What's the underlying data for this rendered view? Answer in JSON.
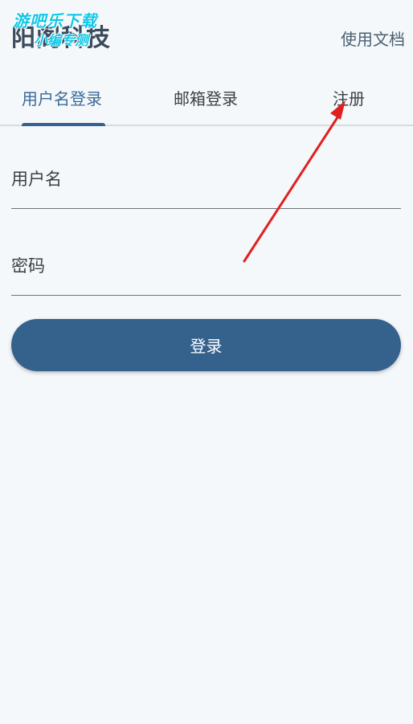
{
  "header": {
    "title": "阳阁科技",
    "docs_link": "使用文档",
    "watermark_line1": "游吧乐下载",
    "watermark_line2": "小编专测"
  },
  "tabs": [
    {
      "label": "用户名登录",
      "active": true
    },
    {
      "label": "邮箱登录",
      "active": false
    },
    {
      "label": "注册",
      "active": false
    }
  ],
  "form": {
    "username_placeholder": "用户名",
    "password_placeholder": "密码",
    "login_label": "登录"
  },
  "colors": {
    "accent": "#35618d",
    "background": "#f4f8fa",
    "annotation_arrow": "#e02020"
  }
}
